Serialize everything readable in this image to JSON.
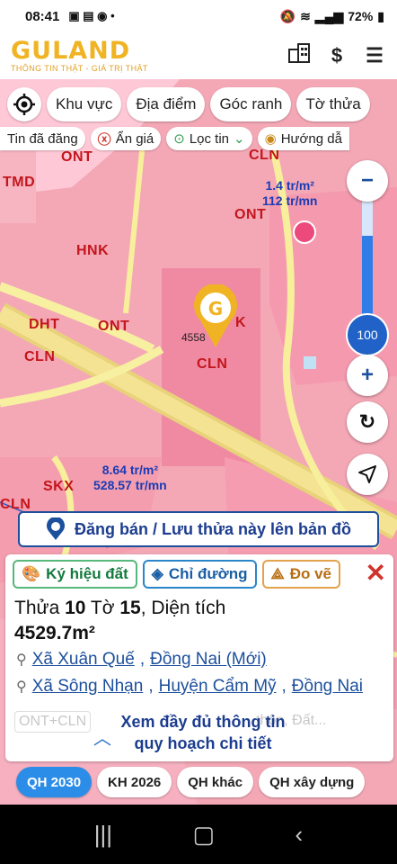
{
  "status": {
    "time": "08:41",
    "battery": "72%"
  },
  "app": {
    "logo": "GULAND",
    "tagline": "THÔNG TIN THẬT - GIÁ TRỊ THẬT"
  },
  "toolbar": {
    "items": [
      "Khu vực",
      "Địa điểm",
      "Góc ranh",
      "Tờ thửa"
    ]
  },
  "filters": {
    "posted": "Tin đã đăng",
    "hide_price": "Ẩn giá",
    "filter": "Lọc tin",
    "direction": "Hướng dẫ"
  },
  "map": {
    "zones": [
      "ONT",
      "CLN",
      "TMD",
      "ONT",
      "HNK",
      "DHT",
      "ONT",
      "CLN",
      "CLN",
      "SKX",
      "K",
      "CLN",
      "ONT"
    ],
    "price_top": {
      "per_m2": "1.4 tr/m²",
      "total": "112 tr/mn"
    },
    "price_bottom": {
      "per_m2": "8.64 tr/m²",
      "total": "528.57 tr/mn"
    },
    "marker_label": "4558",
    "zoom_level": "100",
    "zoom_fraction": 0.72
  },
  "post_banner": "Đăng bán / Lưu thửa này lên bản đồ",
  "card": {
    "actions": [
      "Ký hiệu đất",
      "Chỉ đường",
      "Đo vẽ"
    ],
    "parcel_prefix": "Thửa",
    "parcel_no": "10",
    "sheet_prefix": "Tờ",
    "sheet_no": "15",
    "area_label": ", Diện tích",
    "area": "4529.7m²",
    "address_new": [
      "Xã Xuân Quế",
      "Đồng Nai (Mới)"
    ],
    "address_old": [
      "Xã Sông Nhạn",
      "Huyện Cẩm Mỹ",
      "Đồng Nai"
    ],
    "faded": [
      "ONT+CLN",
      "thôn, Đất..."
    ],
    "more_line1": "Xem đầy đủ thông tin",
    "more_line2": "quy hoạch chi tiết"
  },
  "tabs": [
    "QH 2030",
    "KH 2026",
    "QH khác",
    "QH xây dựng"
  ]
}
